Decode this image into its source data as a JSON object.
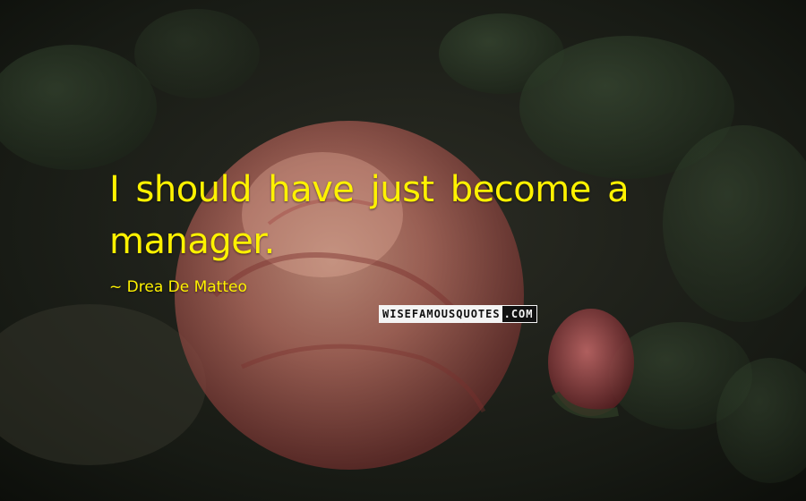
{
  "quote": {
    "text": "I should have just become a manager.",
    "attribution": "~ Drea De Matteo"
  },
  "watermark": {
    "left_text": "WISEFAMOUSQUOTES",
    "right_text": ".COM"
  },
  "background": {
    "subject": "pink rose with dark green leaves",
    "colors": {
      "text": "#fff200",
      "rose": "#c86a68",
      "leaves": "#2a3a26",
      "shadow": "#141812"
    }
  }
}
